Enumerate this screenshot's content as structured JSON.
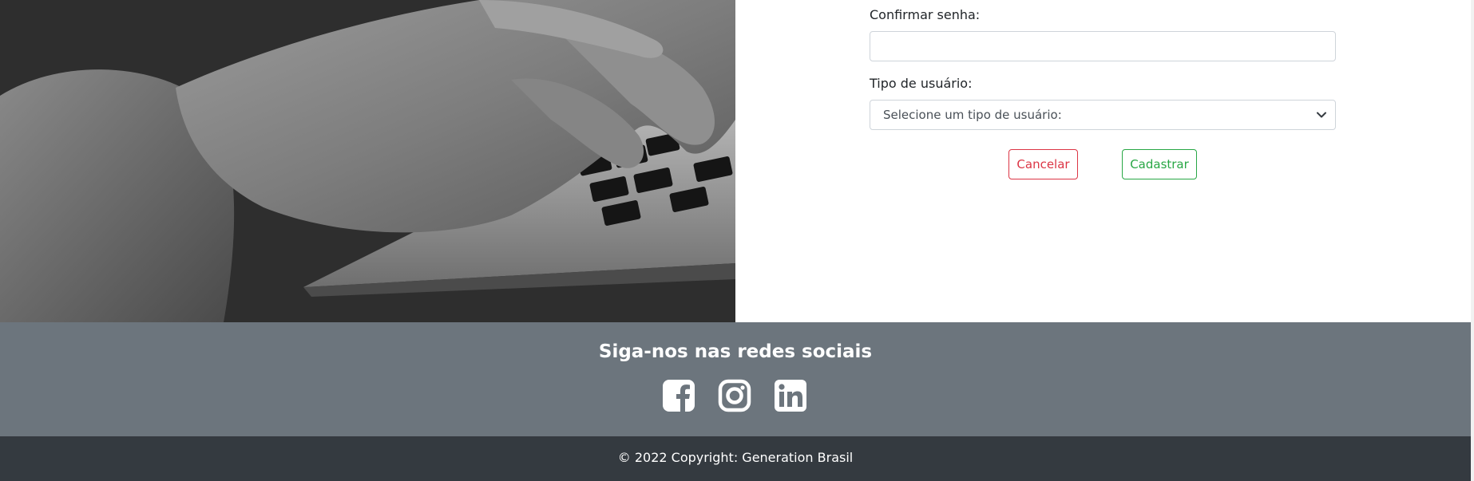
{
  "form": {
    "confirm_password_label": "Confirmar senha:",
    "confirm_password_value": "",
    "user_type_label": "Tipo de usuário:",
    "user_type_selected": "Selecione um tipo de usuário:",
    "cancel_label": "Cancelar",
    "submit_label": "Cadastrar"
  },
  "footer": {
    "social_title": "Siga-nos nas redes sociais",
    "social_icons": [
      "facebook-icon",
      "instagram-icon",
      "linkedin-icon"
    ],
    "copyright": "© 2022 Copyright: Generation Brasil"
  },
  "colors": {
    "cancel": "#dc3545",
    "submit": "#28a745",
    "footer_social_bg": "#6c757d",
    "footer_copy_bg": "#343a40"
  }
}
